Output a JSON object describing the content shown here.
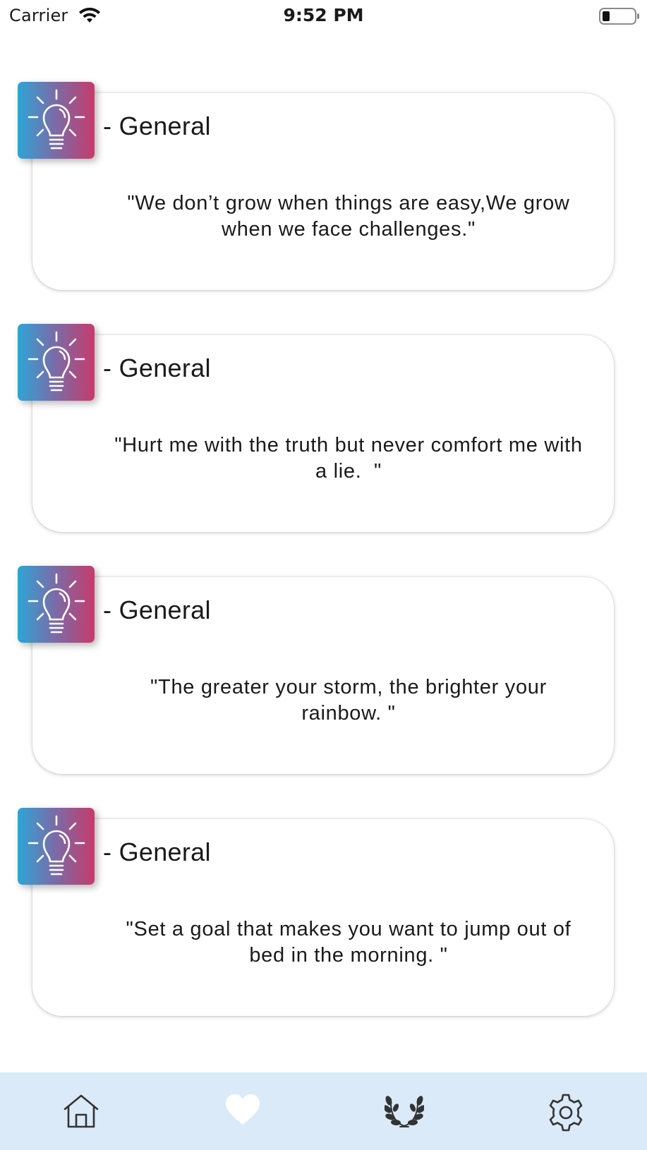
{
  "status_bar": {
    "carrier": "Carrier",
    "time": "9:52 PM",
    "icons": [
      "wifi-icon",
      "battery-icon"
    ]
  },
  "cards": [
    {
      "icon": "lightbulb-icon",
      "category": "- General",
      "quote": "\"We don’t grow when things are easy,We grow when we face challenges.\""
    },
    {
      "icon": "lightbulb-icon",
      "category": "- General",
      "quote": "\"Hurt me with the truth but never comfort me with a lie.  \""
    },
    {
      "icon": "lightbulb-icon",
      "category": "- General",
      "quote": "\"The greater your storm, the brighter your rainbow. \""
    },
    {
      "icon": "lightbulb-icon",
      "category": "- General",
      "quote": "\"Set a goal that makes you want to jump out of bed in the morning. \""
    }
  ],
  "tab_bar": {
    "background": "#daeaf8",
    "tabs": [
      {
        "icon": "home-icon",
        "selected": false
      },
      {
        "icon": "heart-icon",
        "selected": true
      },
      {
        "icon": "laurel-icon",
        "selected": false
      },
      {
        "icon": "gear-icon",
        "selected": false
      }
    ]
  },
  "colors": {
    "badge_gradient_start": "#2ea4d6",
    "badge_gradient_end": "#c63b6b",
    "text": "#1a1a1a",
    "card_background": "#ffffff"
  }
}
